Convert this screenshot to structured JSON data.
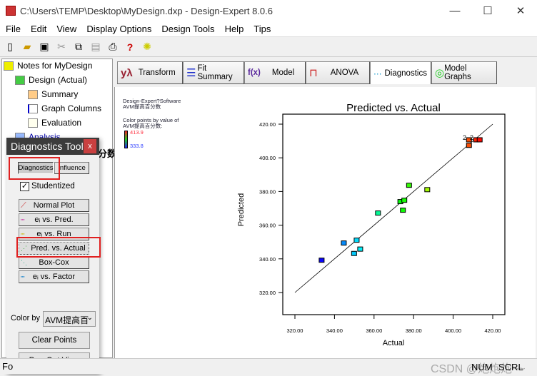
{
  "window": {
    "title": "C:\\Users\\TEMP\\Desktop\\MyDesign.dxp - Design-Expert 8.0.6",
    "minimize": "—",
    "maximize": "☐",
    "close": "✕"
  },
  "menu": [
    "File",
    "Edit",
    "View",
    "Display Options",
    "Design Tools",
    "Help",
    "Tips"
  ],
  "toolbar_icons": [
    "new-icon",
    "open-icon",
    "save-icon",
    "cut-icon",
    "copy-icon",
    "paste-icon",
    "print-icon",
    "help-icon",
    "tip-icon"
  ],
  "tree": {
    "root": "Notes for MyDesign",
    "design": "Design (Actual)",
    "summary": "Summary",
    "graph_columns": "Graph Columns",
    "evaluation": "Evaluation",
    "analysis": "Analysis"
  },
  "tabs": [
    {
      "label": "Transform",
      "icon": "yλ"
    },
    {
      "label": "Fit Summary",
      "icon": "☰"
    },
    {
      "label": "Model",
      "icon": "f(x)"
    },
    {
      "label": "ANOVA",
      "icon": "⊓"
    },
    {
      "label": "Diagnostics",
      "icon": "⋯"
    },
    {
      "label": "Model Graphs",
      "icon": "◎"
    }
  ],
  "active_tab": "Diagnostics",
  "info": {
    "software": "Design-Expert?Software",
    "response": "AVM提高百分数",
    "color_by_label": "Color points by value of",
    "color_by_response": "AVM提高百分数:",
    "max": "413.9",
    "min": "333.8",
    "max_color": "#ff3040",
    "min_color": "#3040ff"
  },
  "diag_tool": {
    "title": "Diagnostics Tool",
    "close": "x",
    "tab_diagnostics": "Diagnostics",
    "tab_influence": "Influence",
    "studentized": "Studentized",
    "studentized_checked": true,
    "buttons": [
      "Normal Plot",
      "eᵢ vs. Pred.",
      "eᵢ vs. Run",
      "Pred. vs. Actual",
      "Box-Cox",
      "eᵢ vs. Factor"
    ],
    "selected": "Pred. vs. Actual",
    "color_by_label": "Color by",
    "color_by_value": "AVM提高百",
    "clear_points": "Clear Points",
    "popout": "Pop-Out View"
  },
  "tree_overlap_text": "分数",
  "status": {
    "left": "Fo",
    "num": "NUM",
    "scrl": "SCRL",
    "watermark": "CSDN @炮炮炮~~"
  },
  "chart_data": {
    "type": "scatter",
    "title": "Predicted vs. Actual",
    "xlabel": "Actual",
    "ylabel": "Predicted",
    "xlim": [
      320,
      420
    ],
    "ylim": [
      320,
      420
    ],
    "xticks": [
      "320.00",
      "340.00",
      "360.00",
      "380.00",
      "400.00",
      "420.00"
    ],
    "yticks": [
      "320.00",
      "340.00",
      "360.00",
      "380.00",
      "400.00",
      "420.00"
    ],
    "reference_line": [
      [
        320,
        320
      ],
      [
        420,
        420
      ]
    ],
    "points": [
      [
        333.5,
        339.2
      ],
      [
        344.7,
        349.4
      ],
      [
        351.2,
        351.1
      ],
      [
        349.9,
        343.2
      ],
      [
        353.0,
        345.8
      ],
      [
        362.0,
        367.2
      ],
      [
        373.3,
        374.0
      ],
      [
        375.3,
        374.8
      ],
      [
        374.6,
        368.9
      ],
      [
        377.7,
        383.7
      ],
      [
        386.9,
        381.1
      ],
      [
        408.0,
        407.4
      ],
      [
        408.0,
        410.7
      ],
      [
        411.6,
        410.7
      ],
      [
        413.4,
        410.7
      ]
    ],
    "annotations": [
      "2",
      "2"
    ],
    "color_range": [
      333.8,
      413.9
    ]
  }
}
